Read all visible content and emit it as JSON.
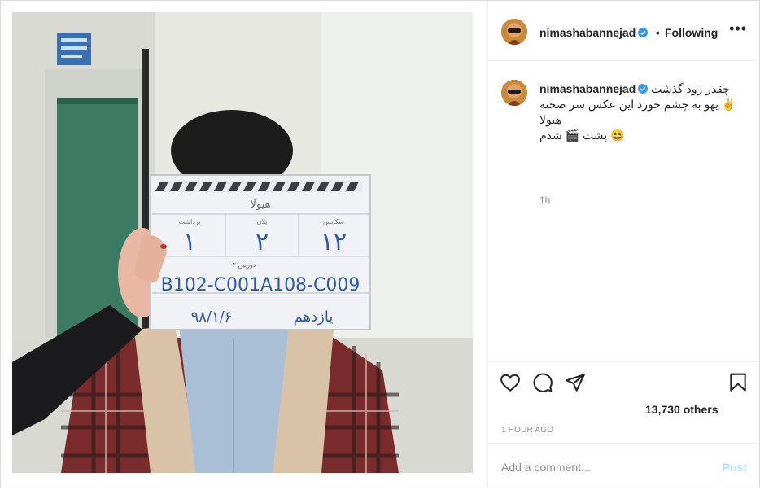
{
  "post": {
    "author": "nimashabannejad",
    "follow_status": "Following",
    "separator": "•",
    "more_label": "•••",
    "caption": {
      "line1": "چقدر زود گذشت",
      "line2": "✌️ یهو به چشم خورد این عکس سر صحنه هیولا",
      "line3": "😆 پشت 🎬 شدم"
    },
    "caption_age": "1h",
    "likes_text": "13,730 others",
    "time_ago": "1 HOUR AGO",
    "comment_placeholder": "Add a comment...",
    "post_button": "Post"
  },
  "slate": {
    "title": "هیولا",
    "row_labels": [
      "سکانس",
      "پلان",
      "برداشت"
    ],
    "sequence": "۱۲",
    "plan": "۲",
    "take": "۱",
    "camera_label": "دوربین ۲",
    "code": "B102-C001A108-C009",
    "day": "یازدهم",
    "date": "۹۸/۱/۶"
  },
  "icons": {
    "like": "heart-icon",
    "comment": "comment-icon",
    "share": "share-icon",
    "save": "bookmark-icon",
    "verified": "verified-badge-icon"
  },
  "colors": {
    "verified": "#3897f0",
    "post_button": "#b2dffc",
    "muted": "#8e8e8e"
  }
}
